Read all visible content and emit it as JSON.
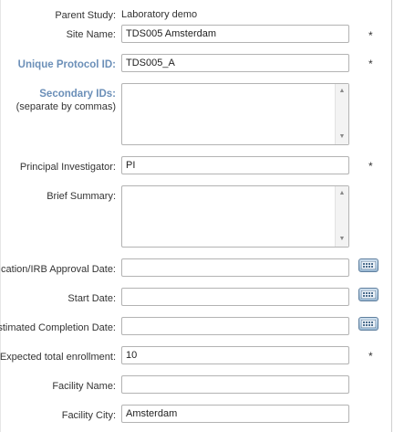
{
  "form": {
    "parent_study": {
      "label": "Parent Study:",
      "value": "Laboratory demo"
    },
    "site_name": {
      "label": "Site Name:",
      "value": "TDS005 Amsterdam",
      "required": "*"
    },
    "unique_protocol_id": {
      "label": "Unique Protocol ID:",
      "value": "TDS005_A",
      "required": "*"
    },
    "secondary_ids": {
      "label": "Secondary IDs:",
      "hint": "(separate by commas)",
      "value": ""
    },
    "principal_investigator": {
      "label": "Principal Investigator:",
      "value": "PI",
      "required": "*"
    },
    "brief_summary": {
      "label": "Brief Summary:",
      "value": ""
    },
    "approval_date": {
      "label": "cation/IRB Approval Date:",
      "value": ""
    },
    "start_date": {
      "label": "Start Date:",
      "value": ""
    },
    "completion_date": {
      "label": "stimated Completion Date:",
      "value": ""
    },
    "expected_enrollment": {
      "label": "Expected total enrollment:",
      "value": "10",
      "required": "*"
    },
    "facility_name": {
      "label": "Facility Name:",
      "value": ""
    },
    "facility_city": {
      "label": "Facility City:",
      "value": "Amsterdam"
    }
  },
  "icons": {
    "calendar": "calendar-icon",
    "scroll_up": "scroll-up-arrow-icon",
    "scroll_down": "scroll-down-arrow-icon"
  },
  "colors": {
    "highlight_label": "#6b8fb8",
    "input_border": "#b3b3b3",
    "calendar_button": "#9ab8d3"
  }
}
